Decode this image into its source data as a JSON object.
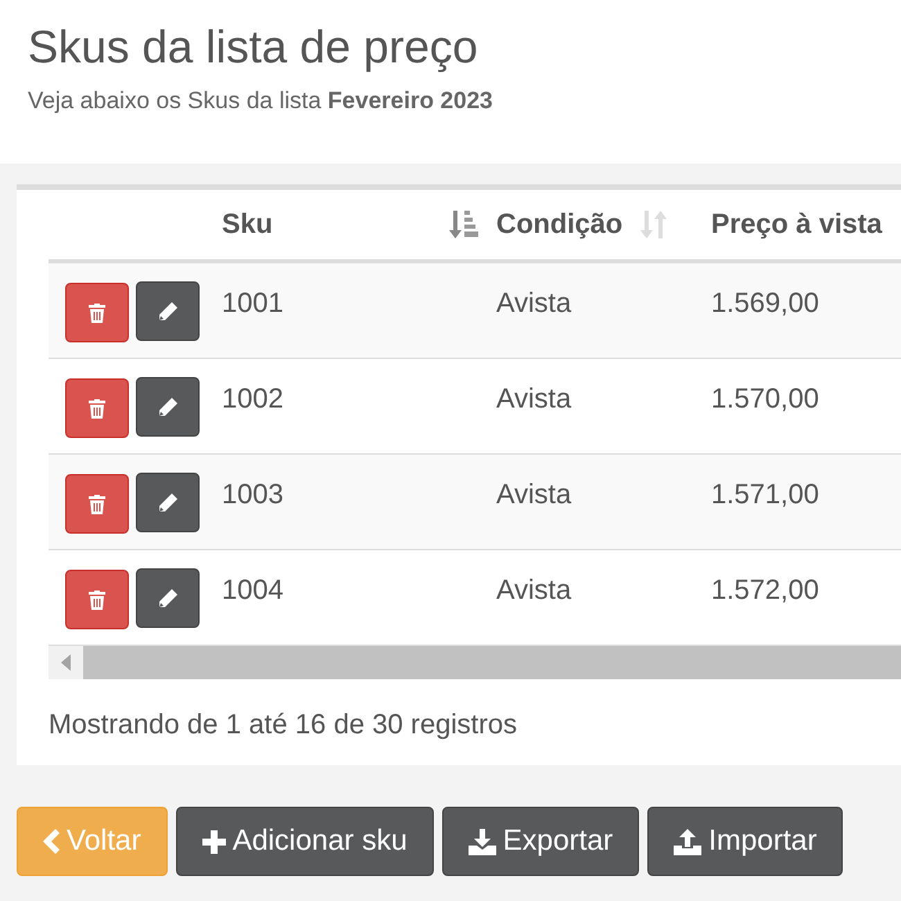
{
  "header": {
    "title": "Skus da lista de preço",
    "subtitle": "Veja abaixo os Skus da lista **Fevereiro 2023**"
  },
  "table": {
    "columns": [
      {
        "label": "Sku",
        "sorted": true
      },
      {
        "label": "Condição",
        "sorted": false
      },
      {
        "label": "Preço à vista"
      }
    ],
    "rows": [
      {
        "cells": [
          "1001",
          "Avista",
          "1.569,00"
        ]
      },
      {
        "cells": [
          "1002",
          "Avista",
          "1.570,00"
        ]
      },
      {
        "cells": [
          "1003",
          "Avista",
          "1.571,00"
        ]
      },
      {
        "cells": [
          "1004",
          "Avista",
          "1.572,00"
        ]
      }
    ]
  },
  "info": "Mostrando de 1 até 16 de 30 registros",
  "buttons": [
    {
      "label": "Voltar",
      "kind": "back"
    },
    {
      "label": "Adicionar sku",
      "kind": "add"
    },
    {
      "label": "Exportar",
      "kind": "export"
    },
    {
      "label": "Importar",
      "kind": "import"
    }
  ]
}
